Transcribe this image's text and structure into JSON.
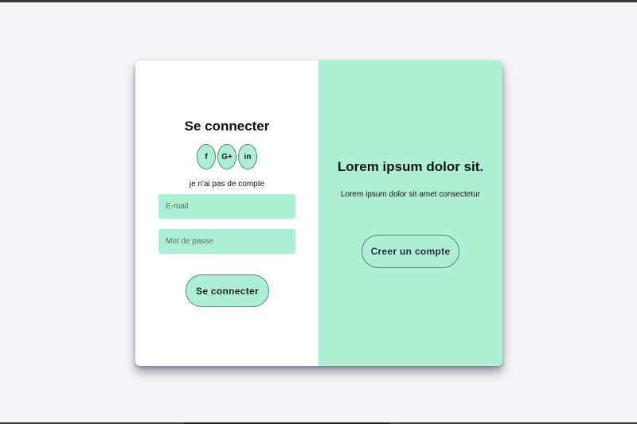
{
  "login": {
    "title": "Se connecter",
    "socials": [
      {
        "icon": "facebook-icon",
        "glyph": "f"
      },
      {
        "icon": "google-plus-icon",
        "glyph": "G+"
      },
      {
        "icon": "linkedin-icon",
        "glyph": "in"
      }
    ],
    "no_account_text": "je n'ai pas de compte",
    "email_placeholder": "E-mail",
    "password_placeholder": "Mot de passe",
    "submit_label": "Se connecter"
  },
  "promo": {
    "title": "Lorem ipsum dolor sit.",
    "text": "Lorem ipsum dolor sit amet consectetur",
    "register_label": "Creer un compte"
  },
  "colors": {
    "accent": "#aef0d3",
    "background": "#f5f5f7",
    "border": "#4d8a74"
  }
}
